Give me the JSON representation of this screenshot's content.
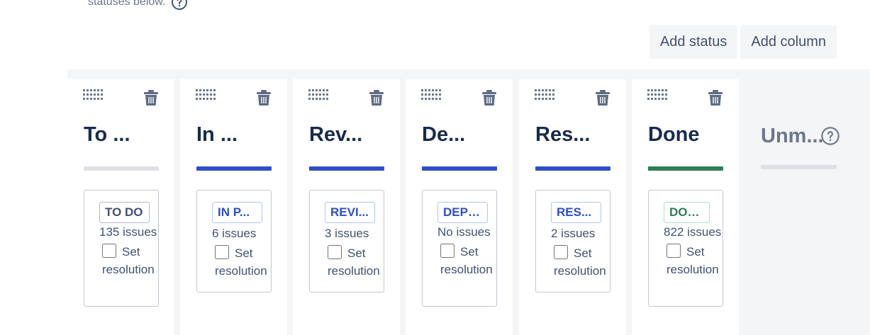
{
  "intro": {
    "text": "statuses below."
  },
  "toolbar": {
    "add_status_label": "Add status",
    "add_column_label": "Add column"
  },
  "colors": {
    "todo_category": "#dfe1e6",
    "in_progress_category": "#2f4fc7",
    "done_category": "#2e7d55",
    "todo_lozenge_text": "#42526e",
    "in_progress_lozenge_text": "#2f4fc7",
    "done_lozenge_text": "#2e7d55"
  },
  "columns": [
    {
      "title": "To ...",
      "status": "TO DO",
      "issues": "135 issues",
      "set_resolution": "Set resolution"
    },
    {
      "title": "In ...",
      "status": "IN P...",
      "issues": "6 issues",
      "set_resolution": "Set resolution"
    },
    {
      "title": "Rev...",
      "status": "REVI...",
      "issues": "3 issues",
      "set_resolution": "Set resolution"
    },
    {
      "title": "De...",
      "status": "DEPL...",
      "issues": "No issues",
      "set_resolution": "Set resolution"
    },
    {
      "title": "Res...",
      "status": "RES...",
      "issues": "2 issues",
      "set_resolution": "Set resolution"
    },
    {
      "title": "Done",
      "status": "DONE",
      "issues": "822 issues",
      "set_resolution": "Set resolution"
    }
  ],
  "unmapped": {
    "title": "Unm..."
  }
}
